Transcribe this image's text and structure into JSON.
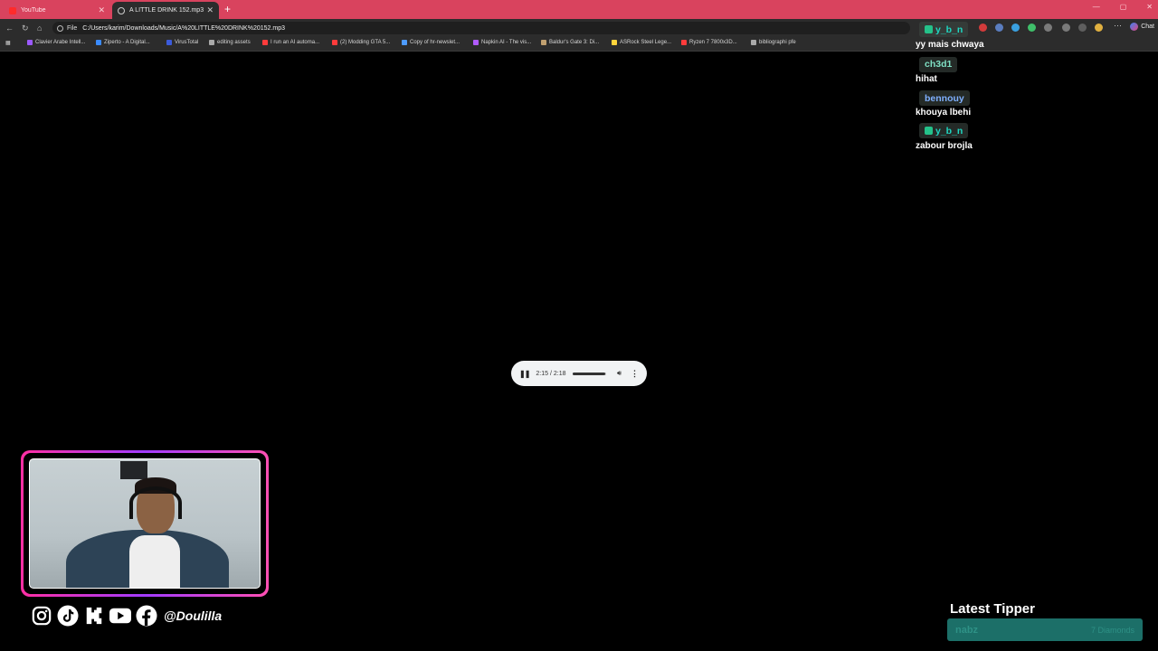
{
  "browser": {
    "tabs": [
      {
        "label": "YouTube",
        "icon": "youtube-icon",
        "active": false
      },
      {
        "label": "A LITTLE DRINK 152.mp3",
        "icon": "globe-icon",
        "active": true
      }
    ],
    "new_tab_symbol": "+",
    "omnibox": {
      "scheme": "File",
      "url": "C:/Users/karim/Downloads/Music/A%20LITTLE%20DRINK%20152.mp3"
    },
    "chat_button_label": "Chat",
    "tab_bar_color": "#d9435e",
    "bookmarks": [
      {
        "label": "Clavier Arabe Intell...",
        "color": "#9b59ff"
      },
      {
        "label": "Ziperto - A Digital...",
        "color": "#3a8bff"
      },
      {
        "label": "VirusTotal",
        "color": "#3b5bdb"
      },
      {
        "label": "editing assets",
        "color": "#aaaaaa"
      },
      {
        "label": "I run an AI automa...",
        "color": "#ff3b3b"
      },
      {
        "label": "(2) Modding GTA 5...",
        "color": "#ff3b3b"
      },
      {
        "label": "Copy of hr-newslet...",
        "color": "#4d9bff"
      },
      {
        "label": "Napkin AI - The vis...",
        "color": "#b05bff"
      },
      {
        "label": "Baldur's Gate 3: Di...",
        "color": "#c0a070"
      },
      {
        "label": "ASRock Steel Lege...",
        "color": "#ffd43b"
      },
      {
        "label": "Ryzen 7 7800x3D...",
        "color": "#ff3b3b"
      },
      {
        "label": "bibliographi pfe",
        "color": "#aaaaaa"
      }
    ]
  },
  "player": {
    "time": "2:15 / 2:18",
    "progress": 0.98
  },
  "chat": [
    {
      "user": "y_b_n",
      "message": "yy mais chwaya",
      "color": "#1fd7c1",
      "badge": true
    },
    {
      "user": "ch3d1",
      "message": "hihat",
      "color": "#7fe0c4",
      "badge": false
    },
    {
      "user": "bennouy",
      "message": "khouya lbehi",
      "color": "#7fb0ff",
      "badge": false
    },
    {
      "user": "y_b_n",
      "message": "zabour brojla",
      "color": "#1fd7c1",
      "badge": true
    }
  ],
  "socials": {
    "icons": [
      "instagram-icon",
      "tiktok-icon",
      "kick-icon",
      "youtube-icon",
      "facebook-icon"
    ],
    "handle": "@Doulilla"
  },
  "tipper": {
    "title": "Latest Tipper",
    "name": "nabz",
    "amount": "7 Diamonds"
  }
}
